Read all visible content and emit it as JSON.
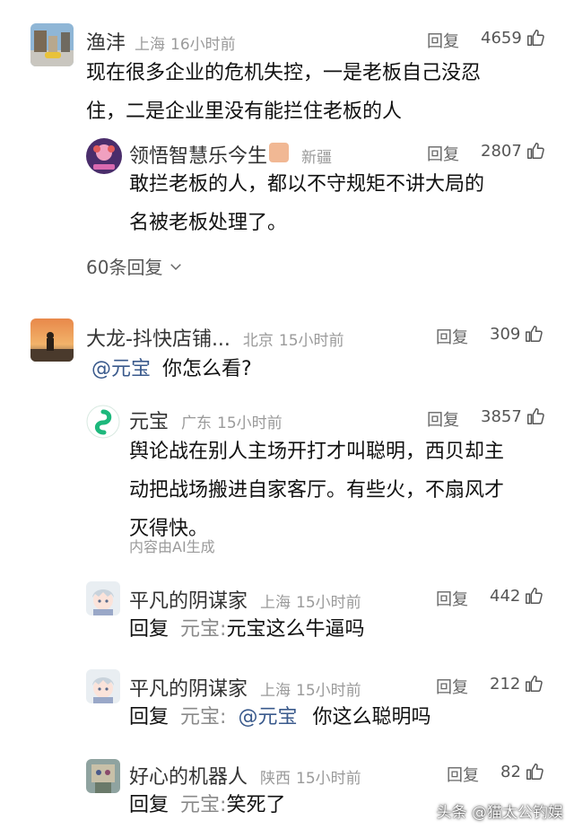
{
  "comments": [
    {
      "name": "渔沣",
      "location": "上海",
      "time": "16小时前",
      "reply_label": "回复",
      "likes": "4659",
      "text_lines": [
        "现在很多企业的危机失控，一是老板自己没忍",
        "住，二是企业里没有能拦住老板的人"
      ],
      "replies_link": "60条回复"
    },
    {
      "name": "领悟智慧乐今生",
      "location": "新疆",
      "reply_label": "回复",
      "likes": "2807",
      "text_lines": [
        "敢拦老板的人，都以不守规矩不讲大局的",
        "名被老板处理了。"
      ]
    },
    {
      "name": "大龙-抖快店铺...",
      "location": "北京",
      "time": "15小时前",
      "reply_label": "回复",
      "likes": "309",
      "mention": "@元宝",
      "text": "你怎么看?"
    },
    {
      "name": "元宝",
      "location": "广东",
      "time": "15小时前",
      "reply_label": "回复",
      "likes": "3857",
      "text_lines": [
        "舆论战在别人主场开打才叫聪明，西贝却主",
        "动把战场搬进自家客厅。有些火，不扇风才",
        "灭得快。"
      ],
      "ai_note": "内容由AI生成"
    },
    {
      "name": "平凡的阴谋家",
      "location": "上海",
      "time": "15小时前",
      "reply_label": "回复",
      "likes": "442",
      "reply_prefix": "回复",
      "reply_target": "元宝:",
      "text": "元宝这么牛逼吗"
    },
    {
      "name": "平凡的阴谋家",
      "location": "上海",
      "time": "15小时前",
      "reply_label": "回复",
      "likes": "212",
      "reply_prefix": "回复",
      "reply_target": "元宝:",
      "mention": "@元宝",
      "text": "你这么聪明吗"
    },
    {
      "name": "好心的机器人",
      "location": "陕西",
      "time": "15小时前",
      "reply_label": "回复",
      "likes": "82",
      "reply_prefix": "回复",
      "reply_target": "元宝:",
      "text": "笑死了"
    }
  ],
  "watermark": "头条 @猫太公钓娱",
  "colors": {
    "mention": "#3a5a8c",
    "meta": "#9a9a9a",
    "ai_icon": "#1db87c"
  }
}
